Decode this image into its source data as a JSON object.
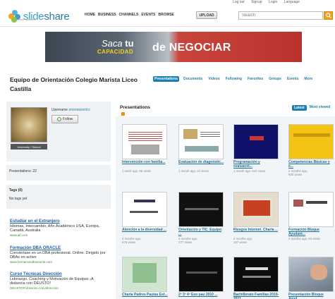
{
  "top_util": [
    "Log out",
    "Signup",
    "Login",
    "Language"
  ],
  "header": {
    "logo_text_a": "slide",
    "logo_text_b": "share",
    "logo_sub": "present yourself",
    "nav": [
      "HOME",
      "BUSINESS",
      "CHANNELS",
      "EVENTS",
      "BROWSE"
    ],
    "upload": "UPLOAD",
    "search_placeholder": "Search"
  },
  "banner": {
    "line1_a": "Saca ",
    "line1_b": "tu",
    "line2": "CAPACIDAD",
    "line3": "de NEGOCIAR"
  },
  "profile": {
    "title": "Equipo de Orientación Colegio Marista Liceo Castilla",
    "tabs": [
      "Presentations",
      "Documents",
      "Videos",
      "Following",
      "Favorites",
      "Groups",
      "Events",
      "More"
    ],
    "username_label": "Username ",
    "username": "orientacionlcc",
    "follow": "Follow",
    "avatar_tag": "University / School",
    "presentations_label": "Presentations: 22",
    "tags_heading": "Tags (0)",
    "tags_empty": "No tags yet"
  },
  "ads": [
    {
      "title": "Estudiar en el Extranjero",
      "body": "Idiomas, Intercambio, Año Académico USA, Europa, Canadá, Australia",
      "url": "www.aif.com"
    },
    {
      "title": "Formación DBA ORACLE",
      "body": "Conviértase en un DBA profesional. Online. Dirigido por DBAs en activo",
      "url": "www.formaciondbaoracle.com"
    },
    {
      "title": "Curso Técnicas Dirección",
      "body": "Liderazgo, Coaching y Motivación de Equipos ¡A distancia con DEUSTO!",
      "url": "DEUSTOFormacion.com/direccion"
    }
  ],
  "presentations": {
    "heading": "Presentations",
    "sort": [
      "Latest",
      "Most viewed"
    ],
    "items": [
      {
        "title": "Intervención con familia...",
        "meta1": "1 week ago, 86 views",
        "meta2": ""
      },
      {
        "title": "Evaluación de diagnóstic...",
        "meta1": "1 month ago, 22 views",
        "meta2": ""
      },
      {
        "title": "Programación y evaluació...",
        "meta1": "1 month ago, 810 views",
        "meta2": ""
      },
      {
        "title": "Competencias Básicas y e...",
        "meta1": "2 months ago,",
        "meta2": "830 views"
      },
      {
        "title": "Atención a la diversidad ...",
        "meta1": "2 months ago,",
        "meta2": "676 views"
      },
      {
        "title": "Orientación y TIC_Equipo ...",
        "meta1": "2 months ago,",
        "meta2": "177 views"
      },
      {
        "title": "Riesgos Internet_Charla ...",
        "meta1": "2 months ago,",
        "meta2": "187 views"
      },
      {
        "title": "Formación Bloque Ayudant...",
        "meta1": "2 months ago, 83 views",
        "meta2": ""
      },
      {
        "title": "Charla Padres Pautas Est...",
        "meta1": "",
        "meta2": ""
      },
      {
        "title": "2º 3º 4º Eso pau 2010 ...",
        "meta1": "",
        "meta2": ""
      },
      {
        "title": "Bachillerato Familias 2010-2011",
        "meta1": "",
        "meta2": ""
      },
      {
        "title": "Presentación Bloque Ayud...",
        "meta1": "",
        "meta2": ""
      }
    ]
  }
}
